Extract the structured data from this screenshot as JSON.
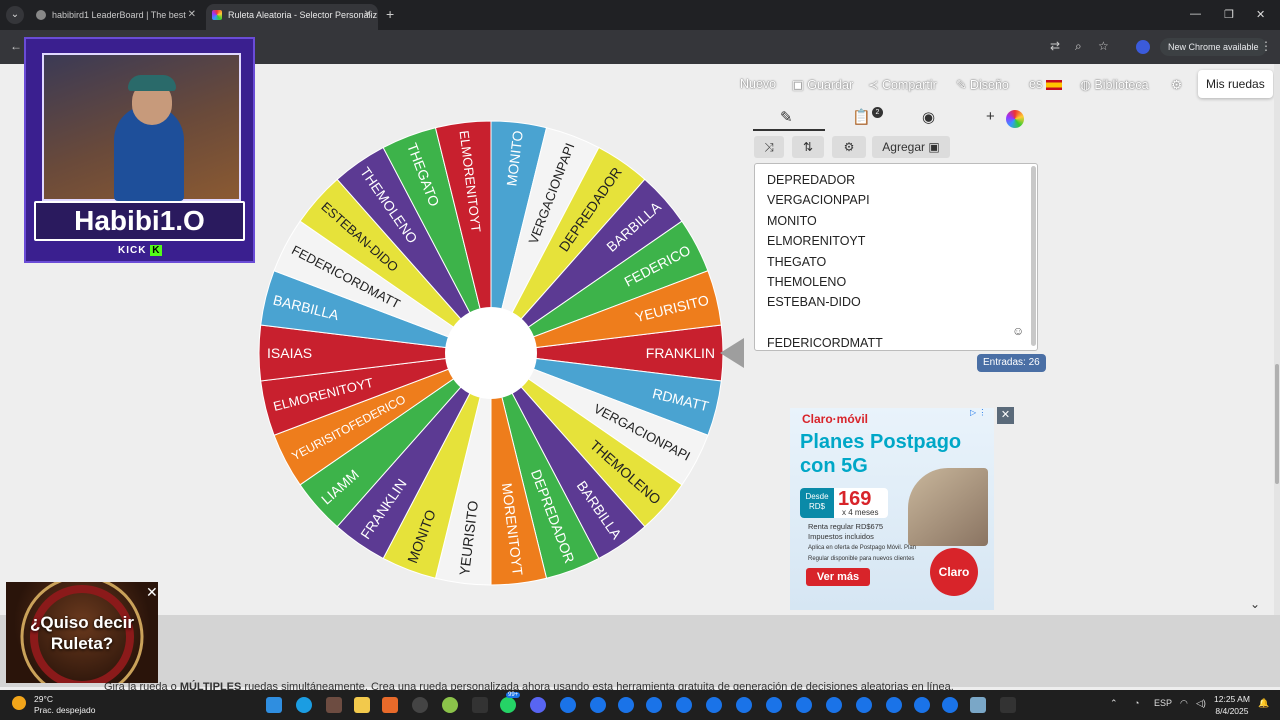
{
  "browser": {
    "tabs": [
      {
        "title": "habibird1 LeaderBoard | The best"
      },
      {
        "title": "Ruleta Aleatoria - Selector Personaliz"
      }
    ],
    "new_chrome_label": "New Chrome available"
  },
  "nav": {
    "nuevo": "Nuevo",
    "guardar": "Guardar",
    "compartir": "Compartir",
    "diseno": "Diseño",
    "lang": "es",
    "biblioteca": "Biblioteca",
    "mis_ruedas": "Mis ruedas"
  },
  "streamer": {
    "name": "Habibi1.O",
    "platform": "KICK"
  },
  "wheel": {
    "segments": [
      {
        "label": "FRANKLIN",
        "color": "#c8202e"
      },
      {
        "label": "RDMATT",
        "color": "#4aa3d1"
      },
      {
        "label": "VERGACIONPAPI",
        "color": "#f4f4f4"
      },
      {
        "label": "THEMOLENO",
        "color": "#e6e23a"
      },
      {
        "label": "BARBILLA",
        "color": "#5c3a93"
      },
      {
        "label": "DEPREDADOR",
        "color": "#3db34a"
      },
      {
        "label": "MORENITOYT",
        "color": "#ee7d1c"
      },
      {
        "label": "YEURISITO",
        "color": "#f4f4f4"
      },
      {
        "label": "MONITO",
        "color": "#e6e23a"
      },
      {
        "label": "FRANKLIN",
        "color": "#5c3a93"
      },
      {
        "label": "LIAMM",
        "color": "#3db34a"
      },
      {
        "label": "YEURISITOFEDERICO",
        "color": "#ee7d1c"
      },
      {
        "label": "ELMORENITOYT",
        "color": "#c8202e"
      },
      {
        "label": "ISAIAS",
        "color": "#c8202e"
      },
      {
        "label": "BARBILLA",
        "color": "#4aa3d1"
      },
      {
        "label": "FEDERICORDMATT",
        "color": "#f4f4f4"
      },
      {
        "label": "ESTEBAN-DIDO",
        "color": "#e6e23a"
      },
      {
        "label": "THEMOLENO",
        "color": "#5c3a93"
      },
      {
        "label": "THEGATO",
        "color": "#3db34a"
      },
      {
        "label": "ELMORENITOYT",
        "color": "#c8202e"
      },
      {
        "label": "MONITO",
        "color": "#4aa3d1"
      },
      {
        "label": "VERGACIONPAPI",
        "color": "#f4f4f4"
      },
      {
        "label": "DEPREDADOR",
        "color": "#e6e23a"
      },
      {
        "label": "BARBILLA",
        "color": "#5c3a93"
      },
      {
        "label": "FEDERICO",
        "color": "#3db34a"
      },
      {
        "label": "YEURISITO",
        "color": "#ee7d1c"
      }
    ]
  },
  "editor": {
    "clipboard_badge": "2",
    "agregar_label": "Agregar",
    "entries": [
      "DEPREDADOR",
      "VERGACIONPAPI",
      "MONITO",
      "ELMORENITOYT",
      "THEGATO",
      "THEMOLENO",
      "ESTEBAN-DIDO",
      "",
      "FEDERICORDMATT"
    ],
    "entries_count_label": "Entradas: 26"
  },
  "ad": {
    "brand": "Claro·móvil",
    "headline_1": "Planes Postpago",
    "headline_2": "con 5G",
    "desde": "Desde RD$",
    "price": "169",
    "price_sub": "x 4 meses",
    "fine_1": "Renta regular RD$675 Impuestos incluidos",
    "fine_2": "Aplica en oferta de Postpago Móvil. Plan Regular disponible para nuevos clientes",
    "cta": "Ver más",
    "logo": "Claro"
  },
  "roulette_ad": {
    "line1": "¿Quiso decir",
    "line2": "Ruleta?"
  },
  "page_text": {
    "prefix": "Gira la rueda o ",
    "bold": "MÚLTIPLES",
    "rest": " ruedas simultáneamente. Crea una rueda personalizada ahora usando esta herramienta gratuita de generación de decisiones aleatorias en línea."
  },
  "taskbar": {
    "temp": "29°C",
    "weather": "Prac. despejado",
    "lang": "ESP",
    "time": "12:25 AM",
    "date": "8/4/2025",
    "badge": "99+"
  }
}
